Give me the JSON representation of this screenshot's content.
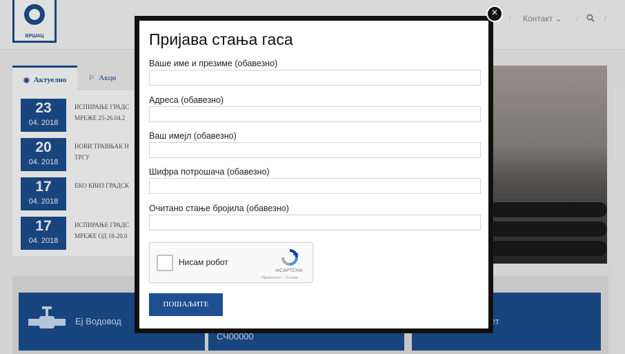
{
  "background": {
    "logo_text": "ВРШАЦ",
    "nav": {
      "contact": "Контакт ⌄",
      "search_icon": "search-icon"
    },
    "tabs": [
      {
        "label": "Актуелно",
        "icon": "rss-icon"
      },
      {
        "label": "Акци",
        "icon": "flag-icon"
      }
    ],
    "news": [
      {
        "day": "23",
        "month_year": "04. 2018",
        "title_l1": "ИСПИРАЊЕ ГРАДС",
        "title_l2": "МРЕЖЕ 25-26.04.2"
      },
      {
        "day": "20",
        "month_year": "04. 2018",
        "title_l1": "НОВИ ТРАВЊАК Н",
        "title_l2": "ТРГУ"
      },
      {
        "day": "17",
        "month_year": "04. 2018",
        "title_l1": "ЕКО КВИЗ ГРАДСК",
        "title_l2": ""
      },
      {
        "day": "17",
        "month_year": "04. 2018",
        "title_l1": "ИСПИРАЊЕ ГРАДС",
        "title_l2": "МРЕЖЕ ОД 18-20.0"
      }
    ],
    "cards": [
      {
        "label": "Еј Водовод"
      },
      {
        "label": "СЧ00000"
      },
      {
        "label": "ет"
      }
    ]
  },
  "modal": {
    "title": "Пријава стања гаса",
    "close_label": "×",
    "fields": [
      {
        "label": "Ваше име и презиме (обавезно)",
        "value": ""
      },
      {
        "label": "Адреса (обавезно)",
        "value": ""
      },
      {
        "label": "Ваш имејл (обавезно)",
        "value": ""
      },
      {
        "label": "Шифра потрошача (обавезно)",
        "value": ""
      },
      {
        "label": "Очитано стање бројила (обавезно)",
        "value": ""
      }
    ],
    "recaptcha": {
      "label": "Нисам робот",
      "brand": "reCAPTCHA",
      "terms": "Приватност - Услови"
    },
    "submit_label": "ПОШАЉИТЕ"
  },
  "colors": {
    "brand_blue": "#1d4f91",
    "modal_border": "#111111"
  }
}
